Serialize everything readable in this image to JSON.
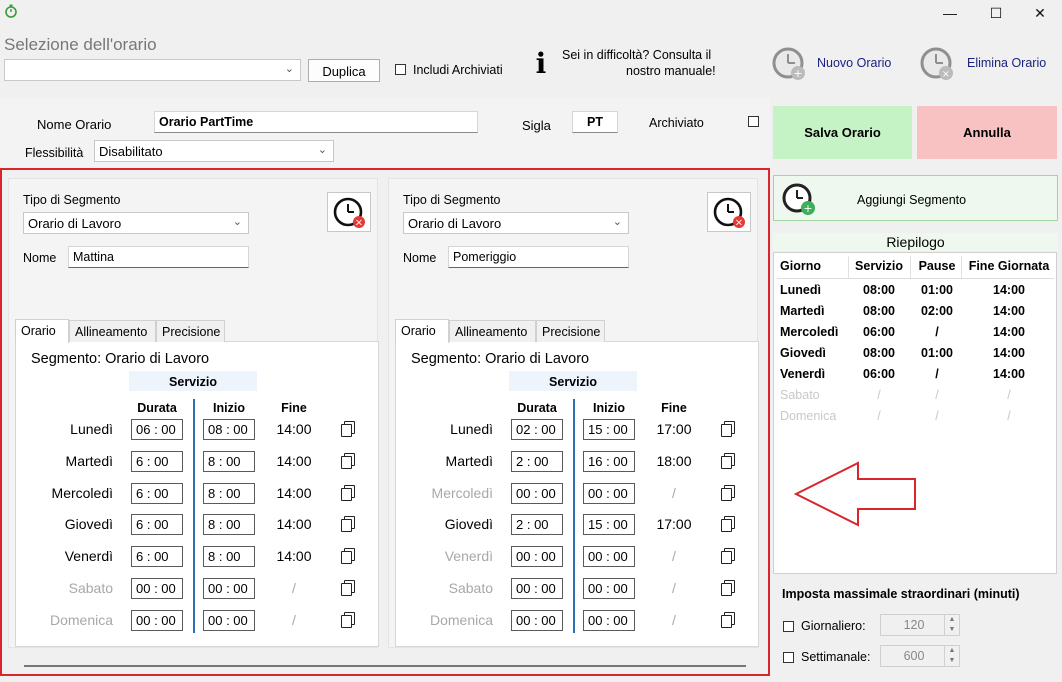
{
  "window": {
    "minimize": "—",
    "maximize": "☐",
    "close": "✕"
  },
  "header": {
    "title": "Selezione dell'orario",
    "duplica_label": "Duplica",
    "includi_archiviati_label": "Includi Archiviati",
    "help_text_1": "Sei in difficoltà? Consulta il",
    "help_text_2": "nostro manuale!",
    "nuovo_orario_label": "Nuovo Orario",
    "elimina_orario_label": "Elimina Orario"
  },
  "form": {
    "nome_orario_label": "Nome Orario",
    "nome_orario_value": "Orario PartTime",
    "sigla_label": "Sigla",
    "sigla_value": "PT",
    "archiviato_label": "Archiviato",
    "flessibilita_label": "Flessibilità",
    "flessibilita_value": "Disabilitato"
  },
  "actions": {
    "salva_label": "Salva Orario",
    "annulla_label": "Annulla",
    "aggiungi_label": "Aggiungi Segmento"
  },
  "segments": [
    {
      "tipo_label": "Tipo di Segmento",
      "tipo_value": "Orario di Lavoro",
      "nome_label": "Nome",
      "nome_value": "Mattina",
      "tabs": [
        "Orario",
        "Allineamento",
        "Precisione"
      ],
      "title": "Segmento: Orario di Lavoro",
      "servizio": "Servizio",
      "durata": "Durata",
      "inizio": "Inizio",
      "fine": "Fine",
      "rows": [
        {
          "day": "Lunedì",
          "durata": "06 : 00",
          "inizio": "08 : 00",
          "fine": "14:00",
          "active": true
        },
        {
          "day": "Martedì",
          "durata": "6  : 00",
          "inizio": "8  : 00",
          "fine": "14:00",
          "active": true
        },
        {
          "day": "Mercoledì",
          "durata": "6  : 00",
          "inizio": "8  : 00",
          "fine": "14:00",
          "active": true
        },
        {
          "day": "Giovedì",
          "durata": "6  : 00",
          "inizio": "8  : 00",
          "fine": "14:00",
          "active": true
        },
        {
          "day": "Venerdì",
          "durata": "6  : 00",
          "inizio": "8  : 00",
          "fine": "14:00",
          "active": true
        },
        {
          "day": "Sabato",
          "durata": "00 : 00",
          "inizio": "00 : 00",
          "fine": "/",
          "active": false
        },
        {
          "day": "Domenica",
          "durata": "00 : 00",
          "inizio": "00 : 00",
          "fine": "/",
          "active": false
        }
      ]
    },
    {
      "tipo_label": "Tipo di Segmento",
      "tipo_value": "Orario di Lavoro",
      "nome_label": "Nome",
      "nome_value": "Pomeriggio",
      "tabs": [
        "Orario",
        "Allineamento",
        "Precisione"
      ],
      "title": "Segmento: Orario di Lavoro",
      "servizio": "Servizio",
      "durata": "Durata",
      "inizio": "Inizio",
      "fine": "Fine",
      "rows": [
        {
          "day": "Lunedì",
          "durata": "02 : 00",
          "inizio": "15 : 00",
          "fine": "17:00",
          "active": true
        },
        {
          "day": "Martedì",
          "durata": "2  : 00",
          "inizio": "16 : 00",
          "fine": "18:00",
          "active": true
        },
        {
          "day": "Mercoledì",
          "durata": "00 : 00",
          "inizio": "00 : 00",
          "fine": "/",
          "active": false
        },
        {
          "day": "Giovedì",
          "durata": "2  : 00",
          "inizio": "15 : 00",
          "fine": "17:00",
          "active": true
        },
        {
          "day": "Venerdì",
          "durata": "00 : 00",
          "inizio": "00 : 00",
          "fine": "/",
          "active": false
        },
        {
          "day": "Sabato",
          "durata": "00 : 00",
          "inizio": "00 : 00",
          "fine": "/",
          "active": false
        },
        {
          "day": "Domenica",
          "durata": "00 : 00",
          "inizio": "00 : 00",
          "fine": "/",
          "active": false
        }
      ]
    }
  ],
  "riepilogo": {
    "title": "Riepilogo",
    "columns": [
      "Giorno",
      "Servizio",
      "Pause",
      "Fine Giornata"
    ],
    "rows": [
      {
        "day": "Lunedì",
        "servizio": "08:00",
        "pause": "01:00",
        "fine": "14:00",
        "active": true
      },
      {
        "day": "Martedì",
        "servizio": "08:00",
        "pause": "02:00",
        "fine": "14:00",
        "active": true
      },
      {
        "day": "Mercoledì",
        "servizio": "06:00",
        "pause": "/",
        "fine": "14:00",
        "active": true
      },
      {
        "day": "Giovedì",
        "servizio": "08:00",
        "pause": "01:00",
        "fine": "14:00",
        "active": true
      },
      {
        "day": "Venerdì",
        "servizio": "06:00",
        "pause": "/",
        "fine": "14:00",
        "active": true
      },
      {
        "day": "Sabato",
        "servizio": "/",
        "pause": "/",
        "fine": "/",
        "active": false
      },
      {
        "day": "Domenica",
        "servizio": "/",
        "pause": "/",
        "fine": "/",
        "active": false
      }
    ]
  },
  "straordinari": {
    "title": "Imposta massimale straordinari (minuti)",
    "giornaliero_label": "Giornaliero:",
    "giornaliero_value": "120",
    "settimanale_label": "Settimanale:",
    "settimanale_value": "600"
  },
  "colors": {
    "annotation_red": "#d9262c",
    "save_green": "#c6f3c6",
    "cancel_red": "#f8c2c2",
    "accent_blue": "#2f6db5"
  }
}
